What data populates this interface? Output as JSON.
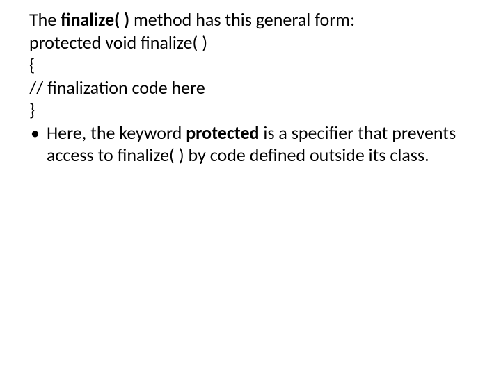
{
  "line1": {
    "pre": "The ",
    "bold": "finalize( ) ",
    "post": "method has this general form:"
  },
  "line2": "protected void finalize( )",
  "line3": "{",
  "line4": "// finalization code here",
  "line5": "}",
  "bullet": {
    "marker": "•",
    "pre": "Here, the keyword ",
    "bold": "protected ",
    "post": "is a specifier that prevents access to finalize( ) by code defined outside its class."
  }
}
